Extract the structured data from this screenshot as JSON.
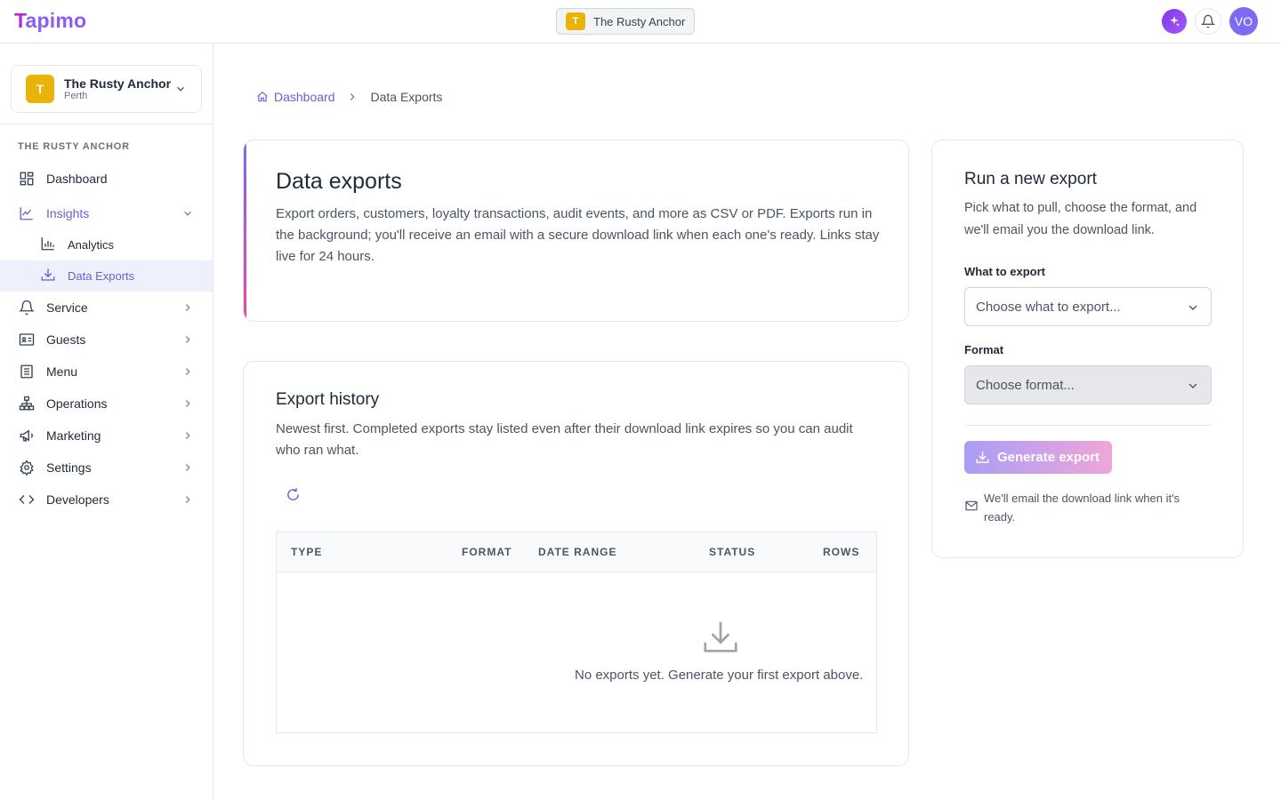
{
  "app": {
    "logo": "Tapimo",
    "logo_first": "T",
    "logo_rest": "apimo"
  },
  "topbar": {
    "venue_badge": "T",
    "venue_name": "The Rusty Anchor",
    "avatar": "VO"
  },
  "sidebar": {
    "venue": {
      "badge": "T",
      "name": "The Rusty Anchor",
      "location": "Perth"
    },
    "section": "THE RUSTY ANCHOR",
    "items": [
      {
        "label": "Dashboard",
        "icon": "dashboard-grid-icon"
      },
      {
        "label": "Insights",
        "icon": "trend-chart-icon",
        "expanded": true
      },
      {
        "label": "Service",
        "icon": "bell-icon"
      },
      {
        "label": "Guests",
        "icon": "id-card-icon"
      },
      {
        "label": "Menu",
        "icon": "document-list-icon"
      },
      {
        "label": "Operations",
        "icon": "hierarchy-icon"
      },
      {
        "label": "Marketing",
        "icon": "megaphone-icon"
      },
      {
        "label": "Settings",
        "icon": "gear-icon"
      },
      {
        "label": "Developers",
        "icon": "code-icon"
      }
    ],
    "subitems": [
      {
        "label": "Analytics",
        "icon": "bar-chart-icon"
      },
      {
        "label": "Data Exports",
        "icon": "download-icon",
        "selected": true
      }
    ]
  },
  "breadcrumb": {
    "home": "Dashboard",
    "current": "Data Exports"
  },
  "intro": {
    "title": "Data exports",
    "body": "Export orders, customers, loyalty transactions, audit events, and more as CSV or PDF. Exports run in the background; you'll receive an email with a secure download link when each one's ready. Links stay live for 24 hours."
  },
  "history": {
    "title": "Export history",
    "body": "Newest first. Completed exports stay listed even after their download link expires so you can audit who ran what.",
    "columns": [
      "TYPE",
      "FORMAT",
      "DATE RANGE",
      "STATUS",
      "ROWS"
    ],
    "empty": "No exports yet. Generate your first export above."
  },
  "run": {
    "title": "Run a new export",
    "body": "Pick what to pull, choose the format, and we'll email you the download link.",
    "what_label": "What to export",
    "what_placeholder": "Choose what to export...",
    "format_label": "Format",
    "format_placeholder": "Choose format...",
    "button": "Generate export",
    "note": "We'll email the download link when it's ready."
  },
  "colors": {
    "accent": "#6d5dd3",
    "brand": "#8b5cf6",
    "venue_badge": "#eab308"
  }
}
